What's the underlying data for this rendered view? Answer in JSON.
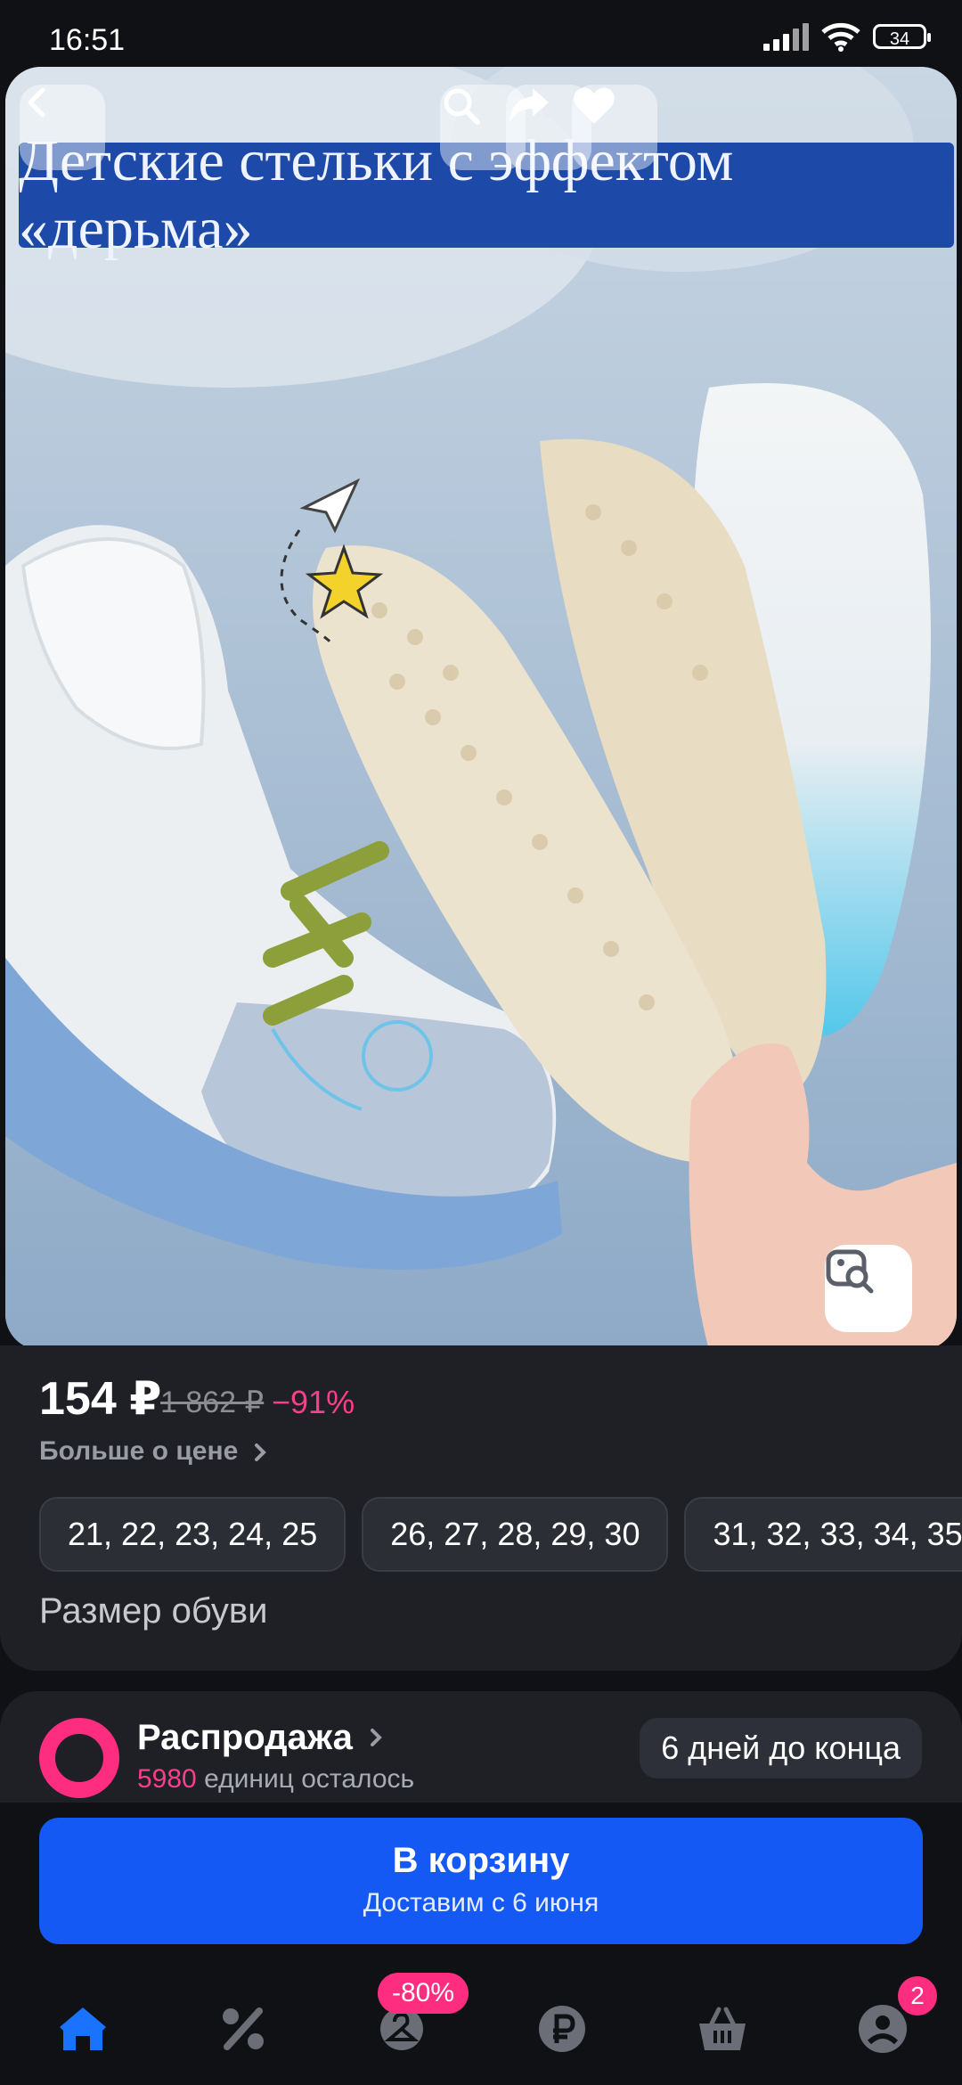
{
  "status_bar": {
    "time": "16:51",
    "battery": "34"
  },
  "hero": {
    "banner_text": "Детские стельки с эффектом «дерьма»",
    "colors": {
      "banner": "#1d49a8",
      "background": "#a8bfd6"
    }
  },
  "price": {
    "current": "154 ₽",
    "old": "1 862 ₽",
    "discount": "−91%",
    "more_link": "Больше о цене"
  },
  "sizes": {
    "options": [
      "21, 22, 23, 24, 25",
      "26, 27, 28, 29, 30",
      "31, 32, 33, 34, 35"
    ],
    "label": "Размер обуви"
  },
  "sale": {
    "title": "Распродажа",
    "remaining_count": "5980",
    "remaining_text": "единиц осталось",
    "timer": "6 дней до конца"
  },
  "cart_button": {
    "label": "В корзину",
    "delivery": "Доставим с 6 июня"
  },
  "nav": {
    "items": [
      "home-icon",
      "percent-icon",
      "hanger-icon",
      "ruble-icon",
      "basket-icon",
      "profile-icon"
    ],
    "promo_badge": "-80%",
    "cart_count": "2",
    "active_color": "#1a73ff"
  }
}
